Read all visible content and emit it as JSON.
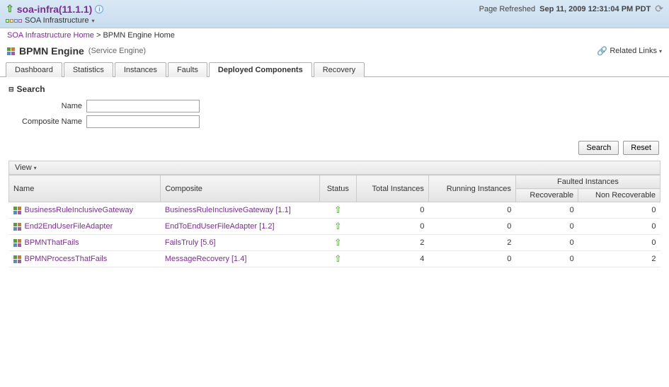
{
  "header": {
    "title": "soa-infra(11.1.1)",
    "infra_label": "SOA Infrastructure",
    "refresh_prefix": "Page Refreshed",
    "refresh_time": "Sep 11, 2009 12:31:04 PM PDT"
  },
  "breadcrumb": {
    "home": "SOA Infrastructure Home",
    "current": "BPMN Engine Home"
  },
  "engine": {
    "title": "BPMN Engine",
    "subtitle": "(Service Engine)",
    "related_links": "Related Links"
  },
  "tabs": {
    "items": [
      {
        "label": "Dashboard",
        "active": false
      },
      {
        "label": "Statistics",
        "active": false
      },
      {
        "label": "Instances",
        "active": false
      },
      {
        "label": "Faults",
        "active": false
      },
      {
        "label": "Deployed Components",
        "active": true
      },
      {
        "label": "Recovery",
        "active": false
      }
    ]
  },
  "search": {
    "header": "Search",
    "name_label": "Name",
    "composite_label": "Composite Name",
    "name_value": "",
    "composite_value": "",
    "search_btn": "Search",
    "reset_btn": "Reset"
  },
  "view_label": "View",
  "table": {
    "headers": {
      "name": "Name",
      "composite": "Composite",
      "status": "Status",
      "total": "Total Instances",
      "running": "Running Instances",
      "faulted": "Faulted Instances",
      "recoverable": "Recoverable",
      "nonrecoverable": "Non Recoverable"
    },
    "rows": [
      {
        "name": "BusinessRuleInclusiveGateway",
        "composite": "BusinessRuleInclusiveGateway [1.1]",
        "status": "up",
        "total": 0,
        "running": 0,
        "recoverable": 0,
        "nonrecoverable": 0
      },
      {
        "name": "End2EndUserFileAdapter",
        "composite": "EndToEndUserFileAdapter [1.2]",
        "status": "up",
        "total": 0,
        "running": 0,
        "recoverable": 0,
        "nonrecoverable": 0
      },
      {
        "name": "BPMNThatFails",
        "composite": "FailsTruly [5.6]",
        "status": "up",
        "total": 2,
        "running": 2,
        "recoverable": 0,
        "nonrecoverable": 0
      },
      {
        "name": "BPMNProcessThatFails",
        "composite": "MessageRecovery [1.4]",
        "status": "up",
        "total": 4,
        "running": 0,
        "recoverable": 0,
        "nonrecoverable": 2
      }
    ]
  }
}
